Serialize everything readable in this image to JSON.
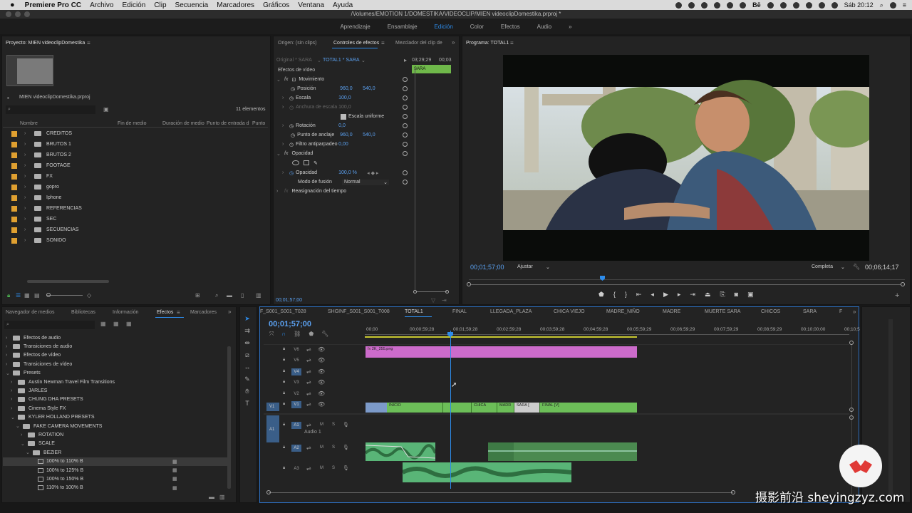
{
  "menubar": {
    "apple": "",
    "app": "Premiere Pro CC",
    "items": [
      "Archivo",
      "Edición",
      "Clip",
      "Secuencia",
      "Marcadores",
      "Gráficos",
      "Ventana",
      "Ayuda"
    ],
    "be": "Bē",
    "datetime": "Sáb 20:12"
  },
  "window": {
    "title": "/Volumes/EMOTION 1/DOMESTIKA/VIDEOCLIP/MIEN videoclipDomestika.prproj *"
  },
  "workspaces": {
    "items": [
      "Aprendizaje",
      "Ensamblaje",
      "Edición",
      "Color",
      "Efectos",
      "Audio"
    ],
    "active": "Edición",
    "more": "»"
  },
  "project": {
    "tab": "Proyecto: MIEN videoclipDomestika",
    "file": "MIEN videoclipDomestika.prproj",
    "count": "11 elementos",
    "columns": [
      "Nombre",
      "Fin de medio",
      "Duración de medio",
      "Punto de entrada d",
      "Punto"
    ],
    "items": [
      "CREDITOS",
      "BRUTOS 1",
      "BRUTOS 2",
      "FOOTAGE",
      "FX",
      "gopro",
      "Iphone",
      "REFERENCIAS",
      "SEC",
      "SECUENCIAS",
      "SONIDO"
    ]
  },
  "effect_controls": {
    "tabs": [
      "Origen: (sin clips)",
      "Controles de efectos",
      "Mezclador del clip de"
    ],
    "master": "Original * SARA",
    "clip": "TOTAL1 * SARA",
    "time_start": "03;29;29",
    "time_end": "00;03",
    "clip_label": "SARA",
    "section": "Efectos de vídeo",
    "rows": {
      "movimiento": "Movimiento",
      "posicion": "Posición",
      "pos_x": "960,0",
      "pos_y": "540,0",
      "escala": "Escala",
      "escala_v": "100,0",
      "anchura": "Anchura de escala",
      "anchura_v": "100,0",
      "uniforme": "Escala uniforme",
      "rotacion": "Rotación",
      "rotacion_v": "0,0",
      "anclaje": "Punto de anclaje",
      "anc_x": "960,0",
      "anc_y": "540,0",
      "filtro": "Filtro antiparpadeo",
      "filtro_v": "0,00",
      "opacidad_sec": "Opacidad",
      "opacidad": "Opacidad",
      "opacidad_v": "100,0 %",
      "fusion": "Modo de fusión",
      "fusion_v": "Normal",
      "reasig": "Reasignación del tiempo"
    },
    "timecode": "00;01;57;00"
  },
  "program": {
    "tab": "Programa: TOTAL1",
    "timecode": "00;01;57;00",
    "fit": "Ajustar",
    "quality": "Completa",
    "duration": "00;06;14;17"
  },
  "effects": {
    "tabs": [
      "Navegador de medios",
      "Bibliotecas",
      "Información",
      "Efectos",
      "Marcadores"
    ],
    "active": "Efectos",
    "rows": [
      {
        "label": "Efectos de audio",
        "indent": 0,
        "open": false
      },
      {
        "label": "Transiciones de audio",
        "indent": 0,
        "open": false
      },
      {
        "label": "Efectos de vídeo",
        "indent": 0,
        "open": false
      },
      {
        "label": "Transiciones de vídeo",
        "indent": 0,
        "open": false
      },
      {
        "label": "Presets",
        "indent": 0,
        "open": true
      },
      {
        "label": "Austin Newman Travel Film Transitions",
        "indent": 1,
        "open": false
      },
      {
        "label": "JARLES",
        "indent": 1,
        "open": false
      },
      {
        "label": "CHUNG DHA PRESETS",
        "indent": 1,
        "open": false
      },
      {
        "label": "Cinema Style FX",
        "indent": 1,
        "open": false
      },
      {
        "label": "KYLER HOLLAND PRESETS",
        "indent": 1,
        "open": true
      },
      {
        "label": "FAKE CAMERA MOVEMENTS",
        "indent": 2,
        "open": true
      },
      {
        "label": "ROTATION",
        "indent": 3,
        "open": false
      },
      {
        "label": "SCALE",
        "indent": 3,
        "open": true
      },
      {
        "label": "BEZIER",
        "indent": 4,
        "open": true
      },
      {
        "label": "100% to 110% B",
        "indent": 5,
        "open": false,
        "sel": true
      },
      {
        "label": "100% to 125% B",
        "indent": 5,
        "open": false
      },
      {
        "label": "100% to 150% B",
        "indent": 5,
        "open": false
      },
      {
        "label": "110% to 100% B",
        "indent": 5,
        "open": false
      }
    ]
  },
  "timeline": {
    "tabs": [
      "F_S001_S001_T028",
      "SHGINF_S001_S001_T008",
      "TOTAL1",
      "FINAL",
      "LLEGADA_PLAZA",
      "CHICA VIEJO",
      "MADRE_NIÑO",
      "MADRE",
      "MUERTE SARA",
      "CHICOS",
      "SARA",
      "F"
    ],
    "active": "TOTAL1",
    "timecode": "00;01;57;00",
    "ruler": [
      "00;00",
      "00;00;59;28",
      "00;01;59;28",
      "00;02;59;28",
      "00;03;59;28",
      "00;04;59;28",
      "00;05;59;29",
      "00;06;59;29",
      "00;07;59;29",
      "00;08;59;29",
      "00;10;00;00",
      "00;10;5"
    ],
    "tracks": [
      "V6",
      "V5",
      "V4",
      "V3",
      "V2",
      "V1",
      "A1",
      "A2",
      "A3"
    ],
    "audio1": "Audio 1",
    "clips": {
      "png": "2K_255.png",
      "inicio": "INICIO",
      "chica": "CHICA",
      "madr": "MADR",
      "sara": "SARA [",
      "final": "FINAL [V]"
    }
  },
  "watermark": "摄影前沿 sheyingzyz.com"
}
